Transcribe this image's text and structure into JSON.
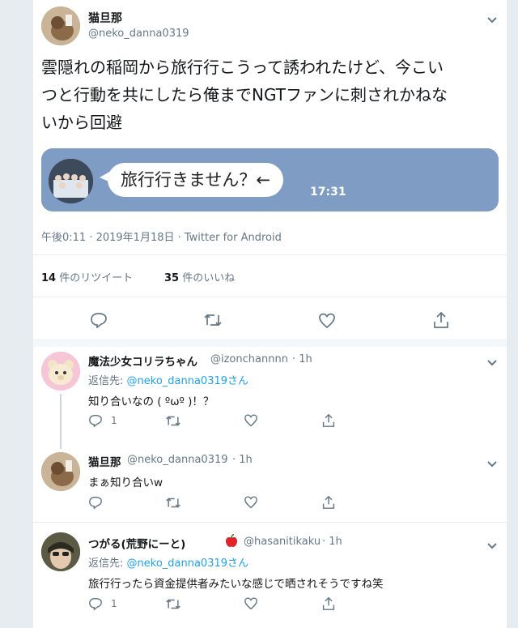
{
  "main": {
    "display_name": "猫旦那",
    "handle": "@neko_danna0319",
    "text_line1": "雲隠れの稲岡から旅行行こうって誘われたけど、今こい",
    "text_line2": "つと行動を共にしたら俺までNGTファンに刺されかねな",
    "text_line3": "いから回避",
    "image": {
      "bubble_text": "旅行行きません？←",
      "time": "17:31"
    },
    "meta": "午後0:11 · 2019年1月18日 · Twitter for Android",
    "retweet_count": "14",
    "retweet_label": "件のリツイート",
    "like_count": "35",
    "like_label": "件のいいね"
  },
  "replies": [
    {
      "name": "魔法少女コリラちゃん",
      "handle": "@izonchannnn",
      "time": "· 1h",
      "reply_to_label": "返信先: ",
      "reply_to_handle": "@neko_danna0319",
      "reply_to_suffix": "さん",
      "text": "知り合いなの ( ºωº )！？",
      "reply_count": "1"
    },
    {
      "name": "猫旦那",
      "handle": "@neko_danna0319",
      "time": "· 1h",
      "text": "まぁ知り合いw"
    },
    {
      "name": "つがる(荒野にーと)",
      "handle": "@hasanitikaku",
      "time": "· 1h",
      "reply_to_label": "返信先: ",
      "reply_to_handle": "@neko_danna0319",
      "reply_to_suffix": "さん",
      "text": "旅行行ったら資金提供者みたいな感じで晒されそうですね笑",
      "reply_count": "1"
    }
  ],
  "icons": [
    "chevron-down-icon",
    "reply-icon",
    "retweet-icon",
    "like-icon",
    "share-icon",
    "apple-emoji-icon"
  ],
  "colors": {
    "link": "#1da1f2",
    "secondary": "#657786",
    "card": "#7f9cc4",
    "background": "#e6ecf0"
  }
}
